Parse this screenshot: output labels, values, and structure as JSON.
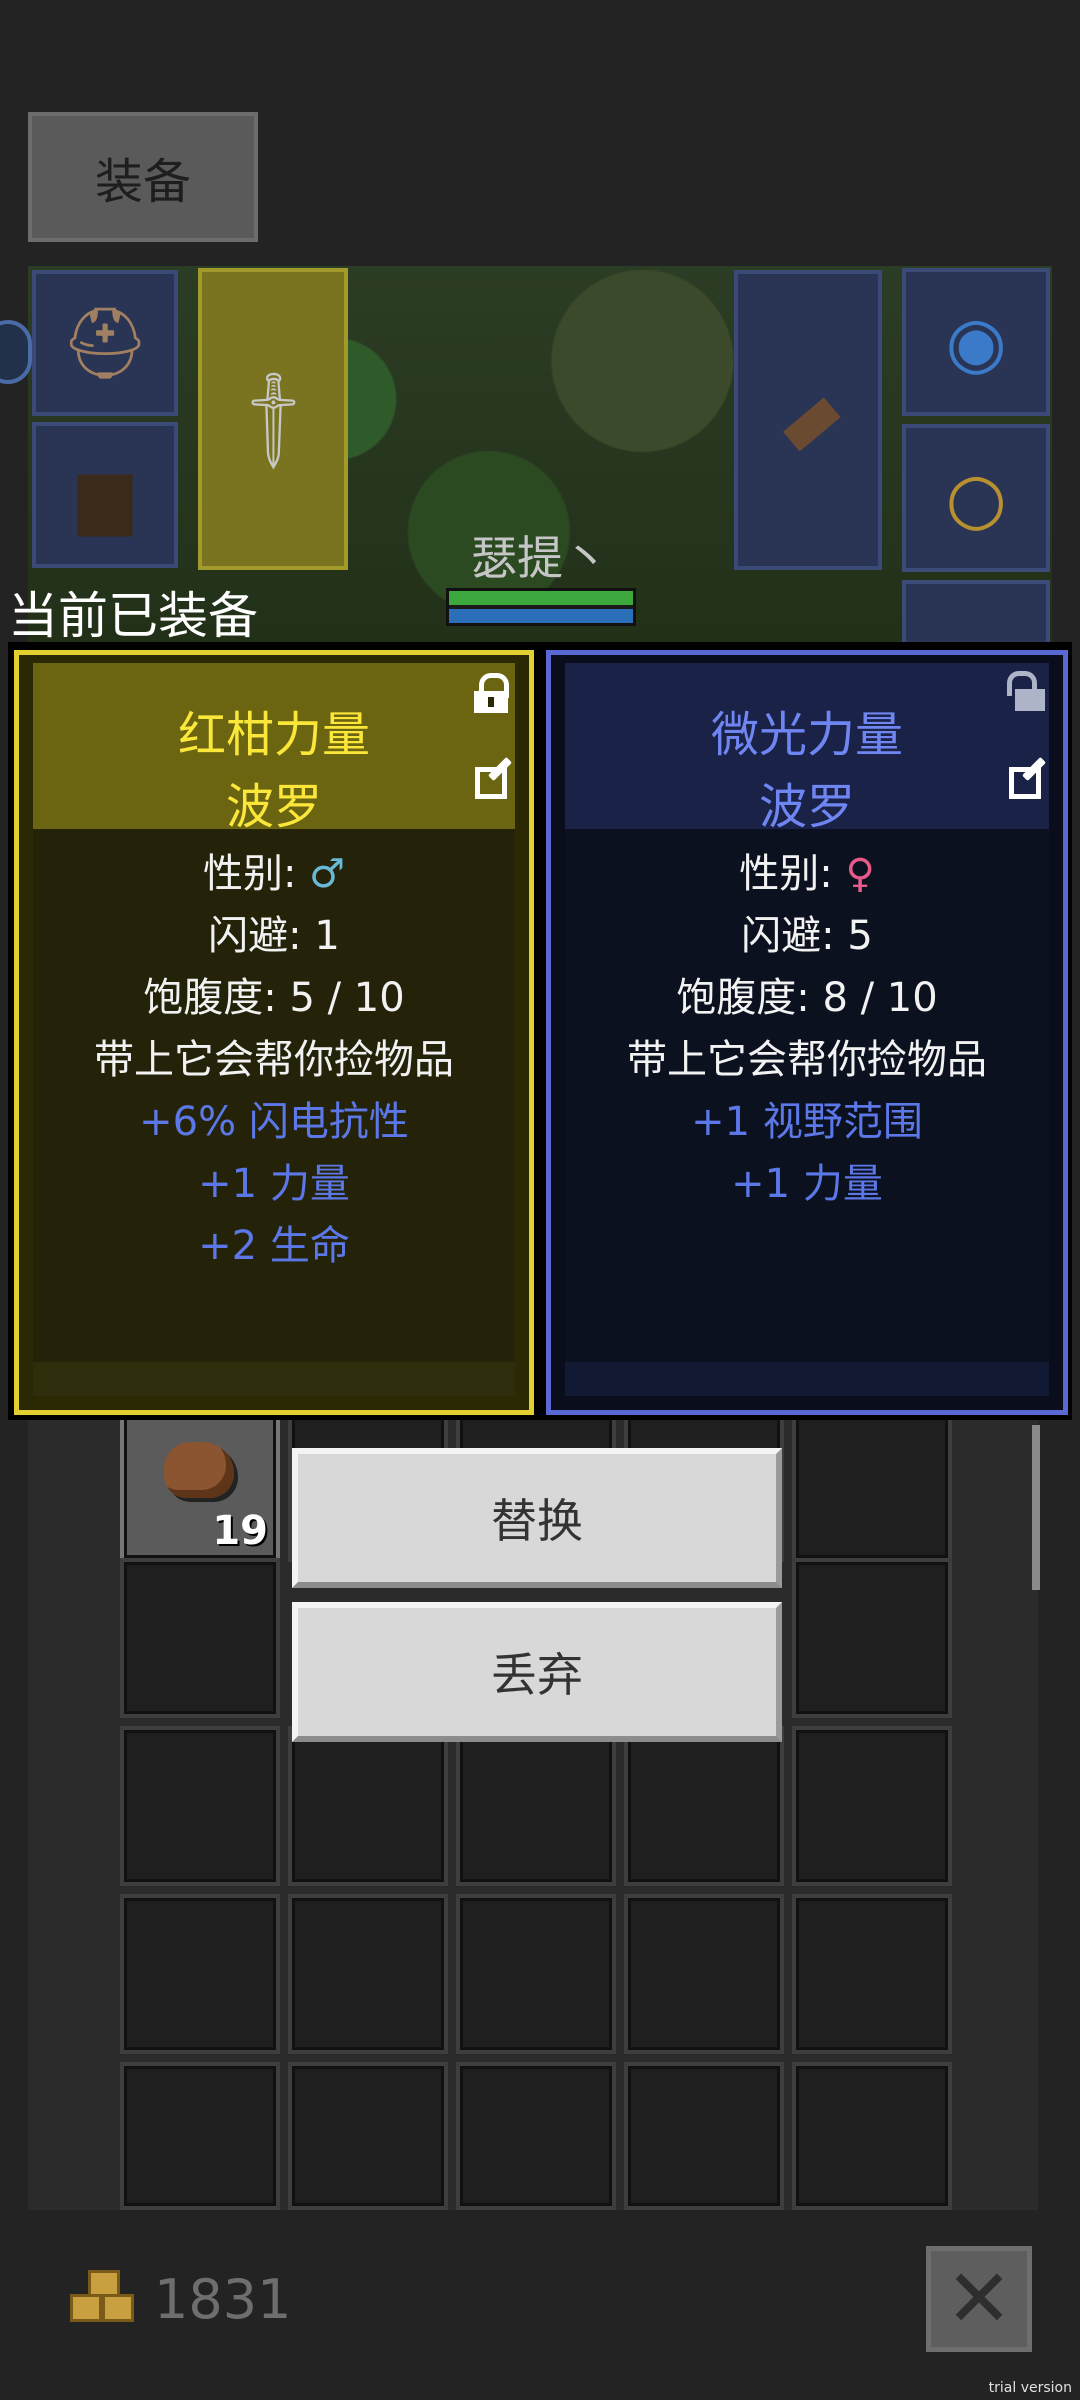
{
  "header": {
    "tab_label": "装备"
  },
  "hero": {
    "name": "瑟提丶"
  },
  "equipped_label": "当前已装备",
  "cards": [
    {
      "title": "红柑力量",
      "subtitle": "波罗",
      "gender_label": "性别:",
      "gender_symbol": "♂",
      "stats": [
        "闪避: 1",
        "饱腹度: 5 / 10",
        "带上它会帮你捡物品"
      ],
      "bonuses": [
        "+6% 闪电抗性",
        "+1 力量",
        "+2 生命"
      ],
      "lock_state": "locked"
    },
    {
      "title": "微光力量",
      "subtitle": "波罗",
      "gender_label": "性别:",
      "gender_symbol": "♀",
      "stats": [
        "闪避: 5",
        "饱腹度: 8 / 10",
        "带上它会帮你捡物品"
      ],
      "bonuses": [
        "+1 视野范围",
        "+1 力量"
      ],
      "lock_state": "unlocked"
    }
  ],
  "actions": {
    "replace": "替换",
    "discard": "丢弃"
  },
  "inventory": {
    "first_item_count": "19"
  },
  "gold": "1831",
  "watermark": "trial version",
  "colors": {
    "left_accent": "#e2cf30",
    "right_accent": "#5a68d4",
    "bonus": "#5c78e8"
  }
}
